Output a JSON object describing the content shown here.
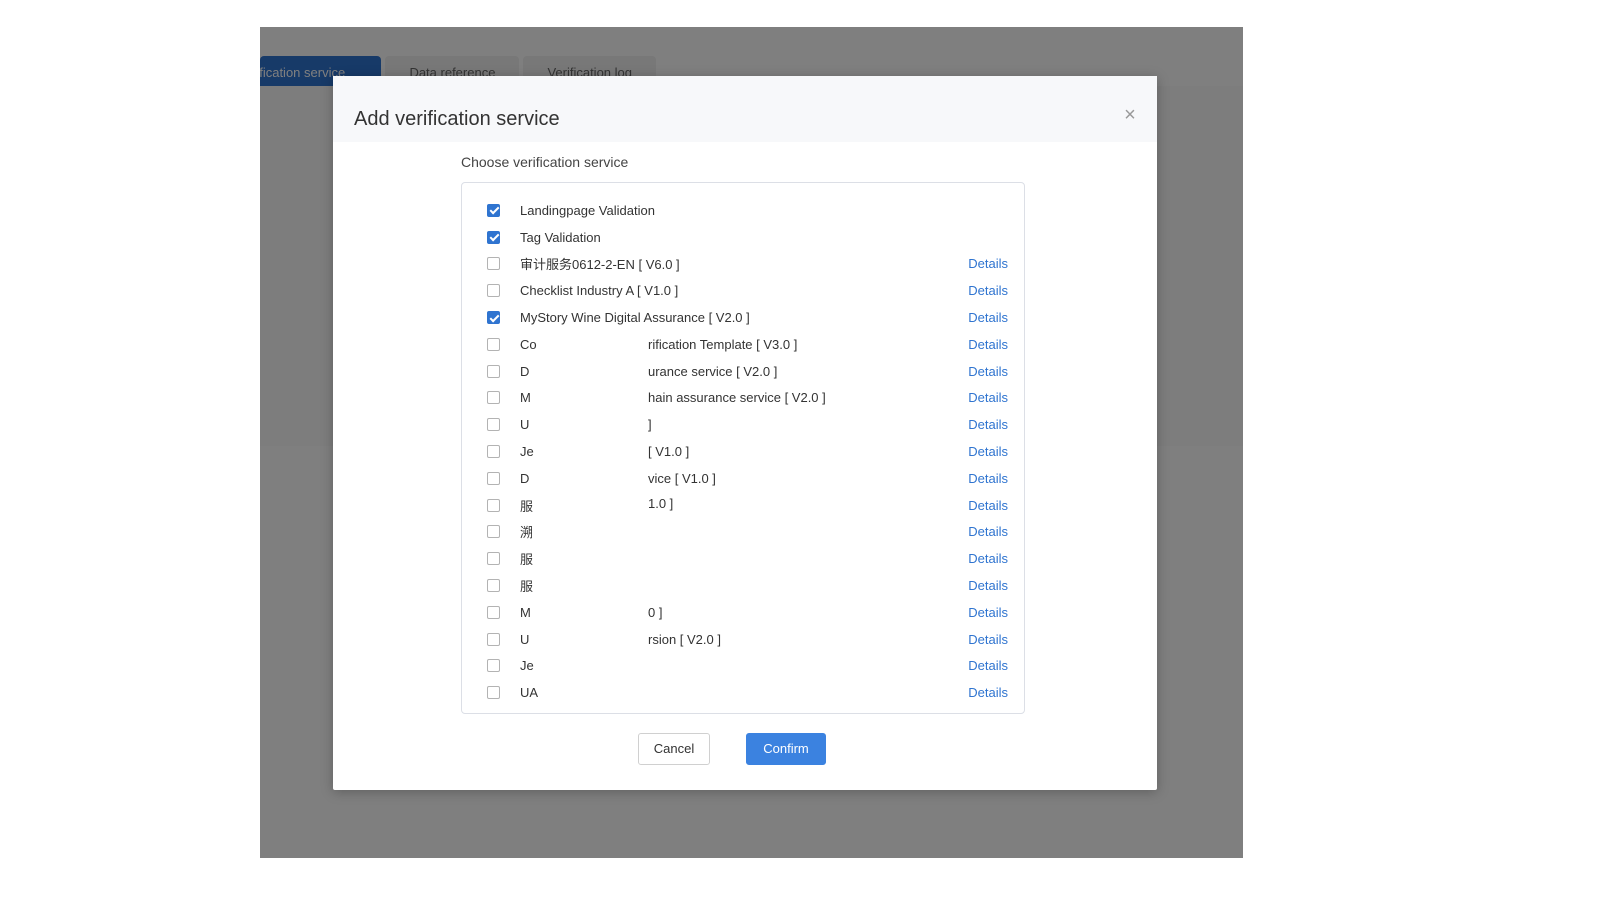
{
  "tabs": [
    {
      "label": "rification service",
      "active": true
    },
    {
      "label": "Data reference",
      "active": false
    },
    {
      "label": "Verification log",
      "active": false
    }
  ],
  "modal": {
    "title": "Add verification service",
    "close_icon": "close-icon",
    "section_label": "Choose verification service",
    "details_label": "Details",
    "cancel_label": "Cancel",
    "confirm_label": "Confirm"
  },
  "services": [
    {
      "name": "Landingpage Validation",
      "tail": "",
      "checked": true,
      "has_details": false
    },
    {
      "name": "Tag Validation",
      "tail": "",
      "checked": true,
      "has_details": false
    },
    {
      "name": "审计服务0612-2-EN [ V6.0 ]",
      "tail": "",
      "checked": false,
      "has_details": true
    },
    {
      "name": "Checklist Industry A [ V1.0 ]",
      "tail": "",
      "checked": false,
      "has_details": true
    },
    {
      "name": "MyStory Wine Digital Assurance [ V2.0 ]",
      "tail": "",
      "checked": true,
      "has_details": true
    },
    {
      "name": "Co",
      "tail": "rification Template [ V3.0 ]",
      "checked": false,
      "has_details": true
    },
    {
      "name": "D",
      "tail": "urance service [ V2.0 ]",
      "checked": false,
      "has_details": true
    },
    {
      "name": "M",
      "tail": "hain assurance service [ V2.0 ]",
      "checked": false,
      "has_details": true
    },
    {
      "name": "U",
      "tail": "]",
      "checked": false,
      "has_details": true
    },
    {
      "name": "Je",
      "tail": "[ V1.0 ]",
      "checked": false,
      "has_details": true
    },
    {
      "name": "D",
      "tail": "vice [ V1.0 ]",
      "checked": false,
      "has_details": true
    },
    {
      "name": "服",
      "tail": "1.0 ]",
      "checked": false,
      "has_details": true
    },
    {
      "name": "溯",
      "tail": "",
      "checked": false,
      "has_details": true
    },
    {
      "name": "服",
      "tail": "",
      "checked": false,
      "has_details": true
    },
    {
      "name": "服",
      "tail": "",
      "checked": false,
      "has_details": true
    },
    {
      "name": "M",
      "tail": "0 ]",
      "checked": false,
      "has_details": true
    },
    {
      "name": "U",
      "tail": "rsion [ V2.0 ]",
      "checked": false,
      "has_details": true
    },
    {
      "name": "Je",
      "tail": "",
      "checked": false,
      "has_details": true
    },
    {
      "name": "UA",
      "tail": "",
      "checked": false,
      "has_details": true
    }
  ]
}
